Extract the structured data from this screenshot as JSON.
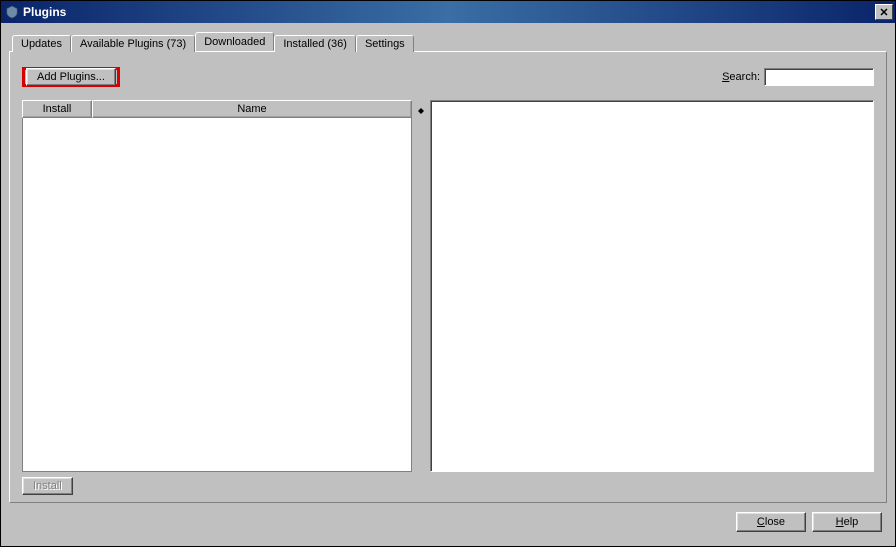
{
  "title": "Plugins",
  "tabs": [
    {
      "label": "Updates"
    },
    {
      "label": "Available Plugins (73)"
    },
    {
      "label": "Downloaded"
    },
    {
      "label": "Installed (36)"
    },
    {
      "label": "Settings"
    }
  ],
  "selected_tab_index": 2,
  "add_plugins_label": "Add Plugins...",
  "search_label": "Search:",
  "search_value": "",
  "columns": {
    "install": "Install",
    "name": "Name"
  },
  "rows": [],
  "install_button_label": "Install",
  "bottom": {
    "close": "Close",
    "help": "Help"
  }
}
